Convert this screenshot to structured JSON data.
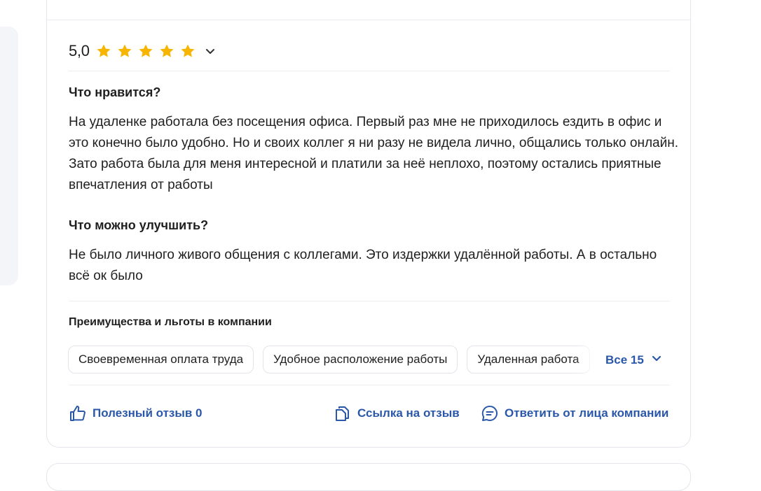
{
  "rating": {
    "value_label": "5,0",
    "stars": 5,
    "star_color": "#f7b500"
  },
  "likes": {
    "title": "Что нравится?",
    "text": "На удаленке работала без посещения офиса. Первый раз мне не приходилось ездить в офис и это конечно было удобно. Но и своих коллег я ни разу не видела лично, общались только онлайн. Зато работа была для меня интересной и платили за неё неплохо, поэтому остались приятные впечатления от работы"
  },
  "improve": {
    "title": "Что можно улучшить?",
    "text": "Не было личного живого общения с коллегами. Это издержки удалённой работы. А в остально всё ок было"
  },
  "benefits": {
    "title": "Преимущества и льготы в компании",
    "chips": [
      "Своевременная оплата труда",
      "Удобное расположение работы",
      "Удаленная работа"
    ],
    "all_label": "Все 15"
  },
  "actions": {
    "helpful": "Полезный отзыв 0",
    "link": "Ссылка на отзыв",
    "reply": "Ответить от лица компании"
  },
  "colors": {
    "accent": "#2a57a8",
    "primary_button": "#4a8cf7"
  }
}
